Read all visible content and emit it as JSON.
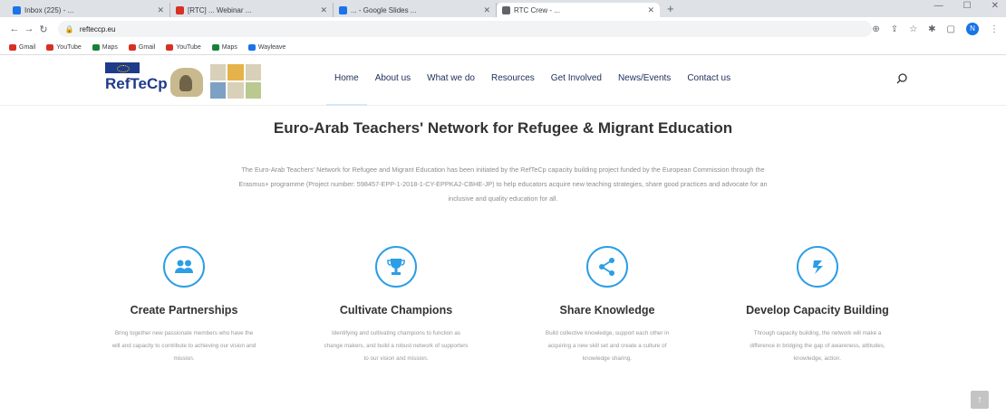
{
  "browser": {
    "tabs": [
      {
        "title": "Inbox (225) - ...",
        "color": "#1a73e8"
      },
      {
        "title": "[RTC] ... Webinar ...",
        "color": "#d93025"
      },
      {
        "title": "... - Google Slides ...",
        "color": "#1a73e8"
      },
      {
        "title": "RTC Crew - ...",
        "color": "#5f6368"
      }
    ],
    "new_tab": "+",
    "url": "refteccp.eu",
    "bookmarks": [
      {
        "label": "Gmail",
        "color": "#d93025"
      },
      {
        "label": "YouTube",
        "color": "#d93025"
      },
      {
        "label": "Maps",
        "color": "#188038"
      },
      {
        "label": "Gmail",
        "color": "#d93025"
      },
      {
        "label": "YouTube",
        "color": "#d93025"
      },
      {
        "label": "Maps",
        "color": "#188038"
      },
      {
        "label": "Wayleave",
        "color": "#1a73e8"
      }
    ],
    "profile_initial": "N"
  },
  "site": {
    "brand": "RefTeCp",
    "nav": [
      "Home",
      "About us",
      "What we do",
      "Resources",
      "Get Involved",
      "News/Events",
      "Contact us"
    ],
    "hero": {
      "title": "Euro-Arab Teachers' Network for Refugee & Migrant Education",
      "text": "The Euro-Arab Teachers' Network for Refugee and Migrant Education has been initiated by the RefTeCp capacity building project funded by the European Commission through the Erasmus+ programme (Project number: 598457-EPP-1-2018-1-CY-EPPKA2-CBHE-JP) to help educators acquire new teaching strategies, share good practices and advocate for an inclusive and quality education for all."
    },
    "features": [
      {
        "icon": "people-icon",
        "title": "Create Partnerships",
        "text": "Bring together new passionate members who have the will and capacity to contribute to achieving our vision and mission."
      },
      {
        "icon": "trophy-icon",
        "title": "Cultivate Champions",
        "text": "Identifying and cultivating champions to function as change makers, and build a robust network of supporters to our vision and mission."
      },
      {
        "icon": "share-icon",
        "title": "Share Knowledge",
        "text": "Build collective knowledge, support each other in acquiring a new skill set and create a culture of knowledge sharing."
      },
      {
        "icon": "capacity-icon",
        "title": "Develop Capacity Building",
        "text": "Through capacity building, the network will make a difference in bridging the gap of awareness, attitudes, knowledge, action."
      }
    ],
    "scroll_top": "↑"
  },
  "colors": {
    "accent": "#2b9ee6",
    "nav_text": "#1f2d5a"
  }
}
